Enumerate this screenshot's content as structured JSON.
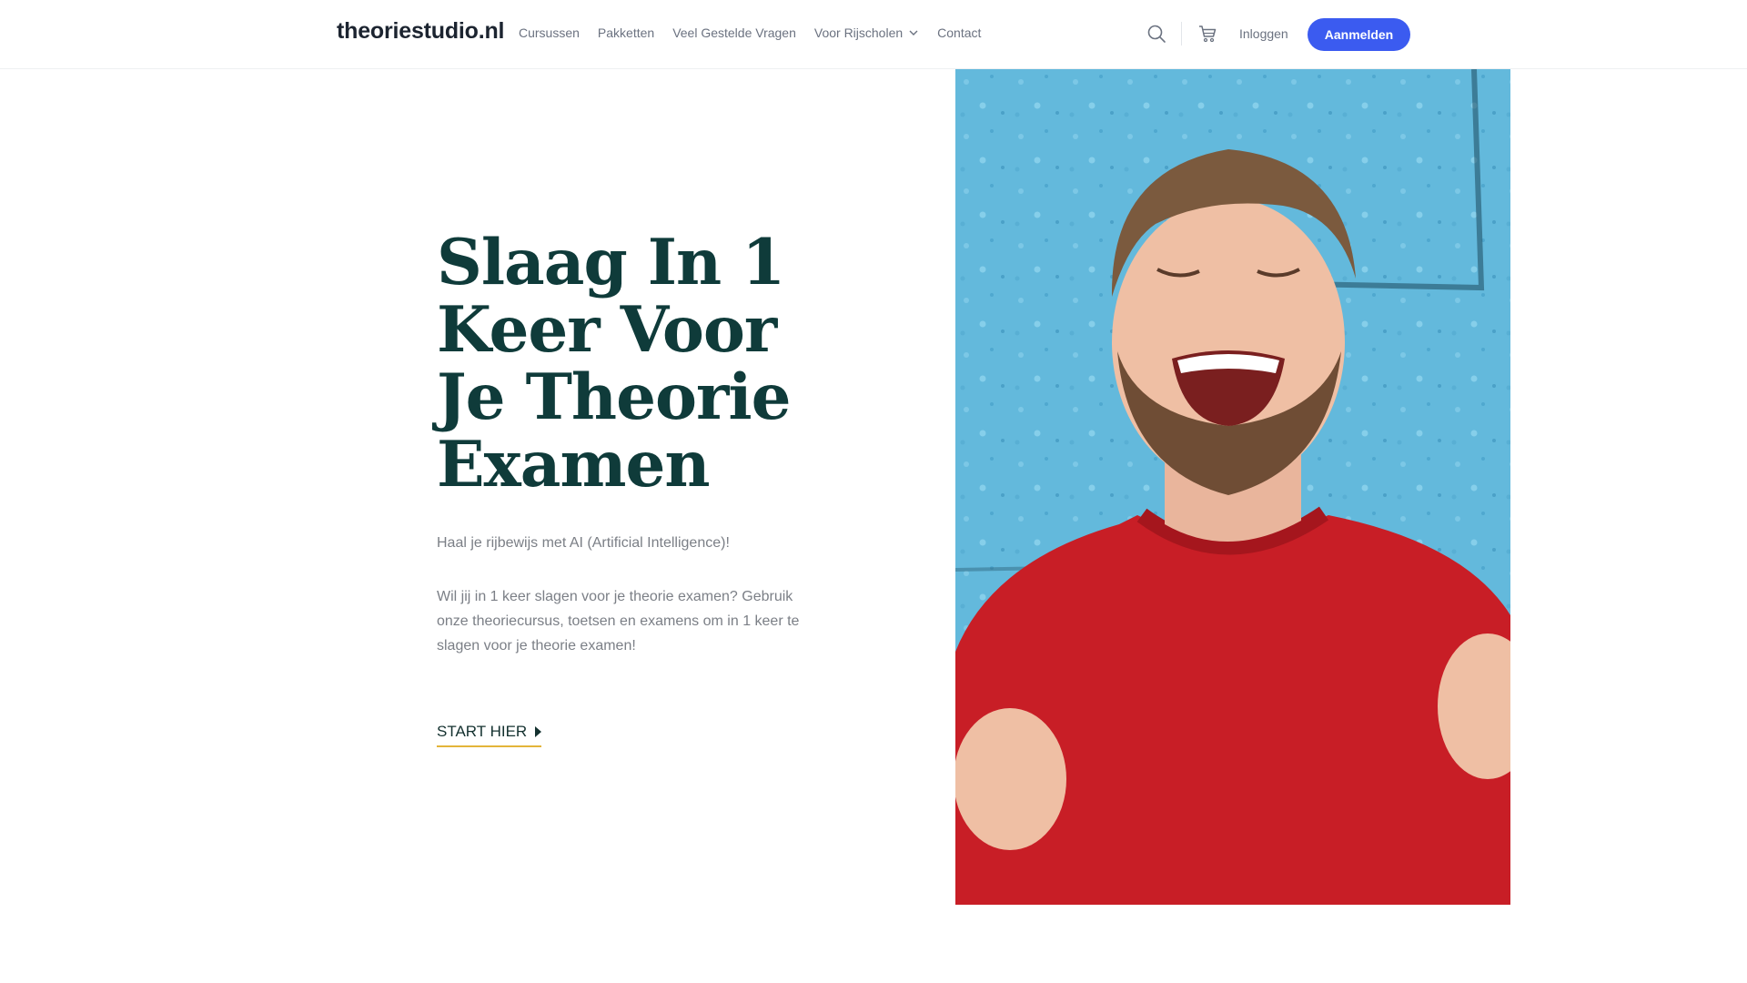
{
  "header": {
    "logo": "theoriestudio.nl",
    "nav": [
      {
        "label": "Cursussen"
      },
      {
        "label": "Pakketten"
      },
      {
        "label": "Veel Gestelde Vragen"
      },
      {
        "label": "Voor Rijscholen",
        "has_dropdown": true
      },
      {
        "label": "Contact"
      }
    ],
    "login_label": "Inloggen",
    "signup_label": "Aanmelden",
    "icons": [
      "search-icon",
      "cart-icon",
      "chevron-down-icon"
    ]
  },
  "hero": {
    "title": "Slaag In 1 Keer Voor Je Theorie Examen",
    "subtitle": "Haal je rijbewijs met AI (Artificial Intelligence)!",
    "body": "Wil jij in 1 keer slagen voor je theorie examen? Gebruik onze theoriecursus, toetsen en examens om in 1 keer te slagen voor je theorie examen!",
    "cta_label": "START HIER"
  },
  "colors": {
    "accent": "#3b5bf0",
    "title": "#0f3b3a",
    "cta_underline": "#e3b53a",
    "image_wall": "#63b9dc",
    "sweater": "#c81e26"
  }
}
